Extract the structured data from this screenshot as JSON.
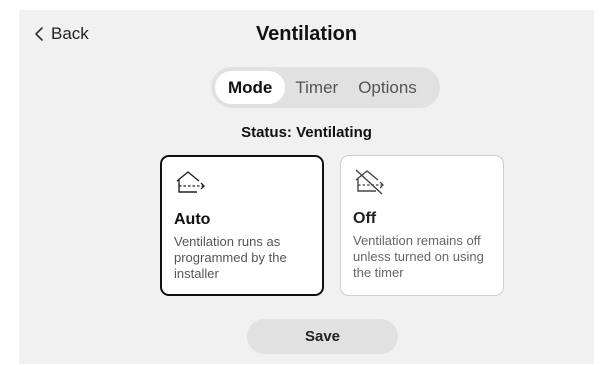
{
  "header": {
    "back_label": "Back",
    "title": "Ventilation"
  },
  "tabs": [
    {
      "label": "Mode",
      "active": true
    },
    {
      "label": "Timer",
      "active": false
    },
    {
      "label": "Options",
      "active": false
    }
  ],
  "status": "Status: Ventilating",
  "modes": [
    {
      "name": "Auto",
      "description": "Ventilation runs as programmed by the installer",
      "icon": "house-airflow-icon",
      "selected": true
    },
    {
      "name": "Off",
      "description": "Ventilation remains off unless turned on using the timer",
      "icon": "house-airflow-off-icon",
      "selected": false
    }
  ],
  "actions": {
    "save_label": "Save"
  },
  "colors": {
    "background": "#f1f1f1",
    "card": "#ffffff",
    "pill": "#e1e1e1",
    "selected_border": "#111111",
    "unselected_border": "#cfcfcf"
  }
}
